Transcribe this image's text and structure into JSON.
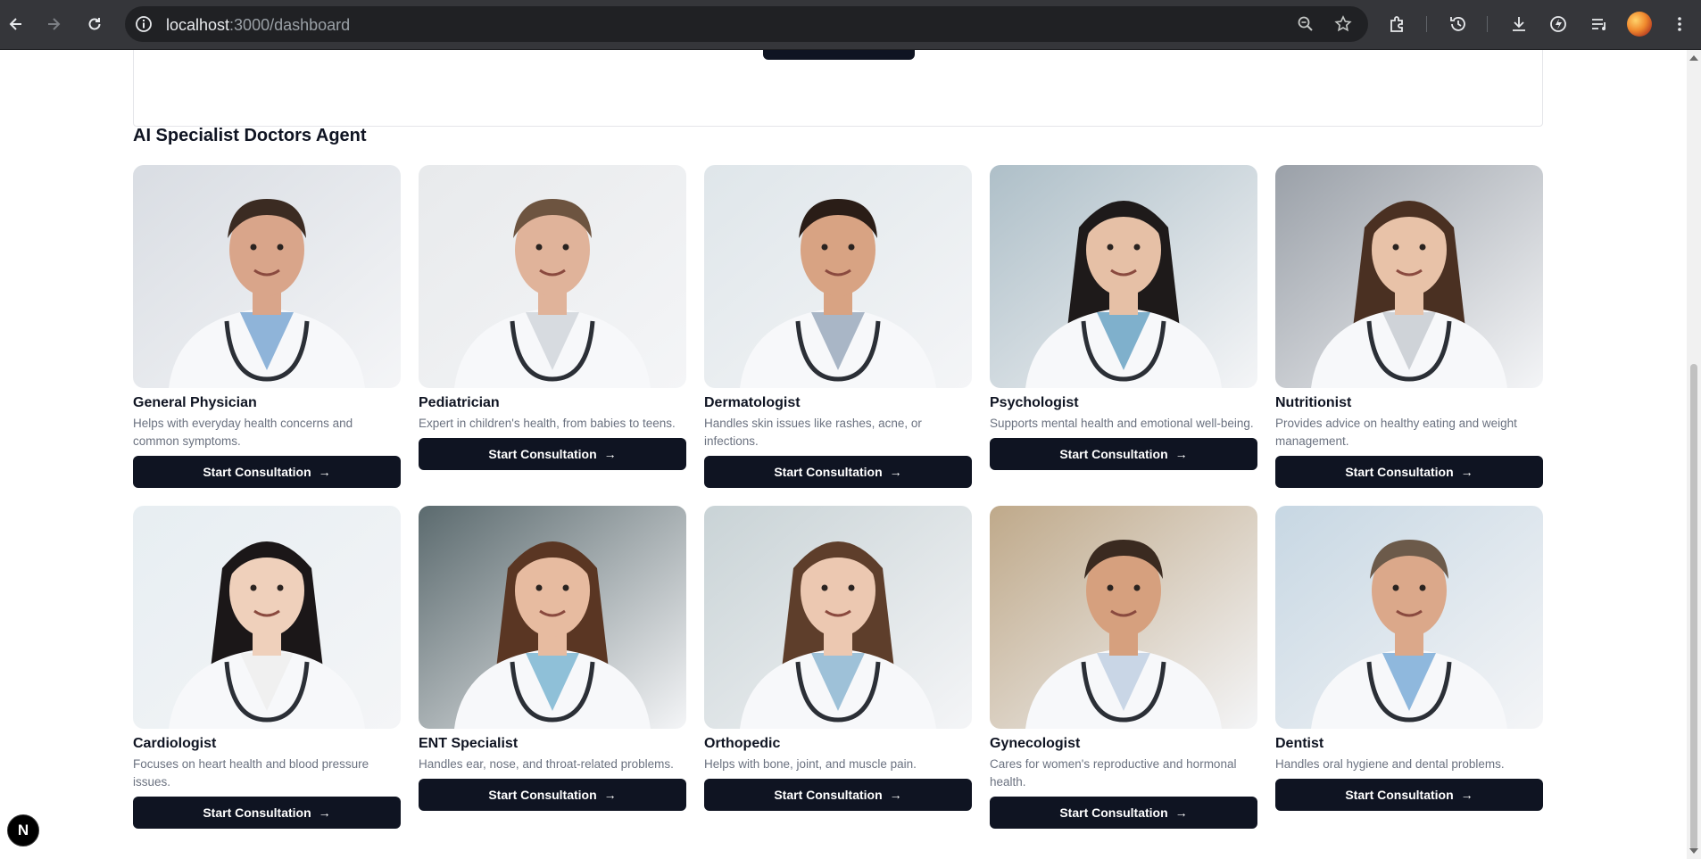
{
  "browser": {
    "url_host": "localhost",
    "url_path": ":3000/dashboard"
  },
  "section": {
    "title": "AI Specialist Doctors Agent"
  },
  "doctors": [
    {
      "name": "General Physician",
      "description": "Helps with everyday health concerns and common symptoms.",
      "button": "Start Consultation"
    },
    {
      "name": "Pediatrician",
      "description": "Expert in children's health, from babies to teens.",
      "button": "Start Consultation"
    },
    {
      "name": "Dermatologist",
      "description": "Handles skin issues like rashes, acne, or infections.",
      "button": "Start Consultation"
    },
    {
      "name": "Psychologist",
      "description": "Supports mental health and emotional well-being.",
      "button": "Start Consultation"
    },
    {
      "name": "Nutritionist",
      "description": "Provides advice on healthy eating and weight management.",
      "button": "Start Consultation"
    },
    {
      "name": "Cardiologist",
      "description": "Focuses on heart health and blood pressure issues.",
      "button": "Start Consultation"
    },
    {
      "name": "ENT Specialist",
      "description": "Handles ear, nose, and throat-related problems.",
      "button": "Start Consultation"
    },
    {
      "name": "Orthopedic",
      "description": "Helps with bone, joint, and muscle pain.",
      "button": "Start Consultation"
    },
    {
      "name": "Gynecologist",
      "description": "Cares for women's reproductive and hormonal health.",
      "button": "Start Consultation"
    },
    {
      "name": "Dentist",
      "description": "Handles oral hygiene and dental problems.",
      "button": "Start Consultation"
    }
  ],
  "photo_palette": {
    "bg": [
      "#d9dde3",
      "#e8eaec",
      "#dfe6ea",
      "#aebfc8",
      "#9aa0a8",
      "#e7eef2",
      "#5b6a6e",
      "#c9d3d6",
      "#bfa98a",
      "#c7d7e3"
    ],
    "skin": [
      "#d9a58a",
      "#e0b39a",
      "#d8a383",
      "#e6c0a6",
      "#e8c2a8",
      "#efd0bb",
      "#e7bba0",
      "#ecc8b1",
      "#d6a07e",
      "#dba88a"
    ],
    "hair": [
      "#3b2b22",
      "#6d5440",
      "#2a1d17",
      "#1e1a1a",
      "#4a3022",
      "#1b1718",
      "#5a3623",
      "#5e3e2b",
      "#3a2a20",
      "#6c5a4a"
    ],
    "shirt": [
      "#8fb4d9",
      "#d7dbe0",
      "#a9b6c6",
      "#7fb0cc",
      "#cfd3d8",
      "#f0f0f0",
      "#8fc0d8",
      "#9ec1d8",
      "#c9d6e6",
      "#8fb8dd"
    ]
  },
  "dev_badge": "N"
}
